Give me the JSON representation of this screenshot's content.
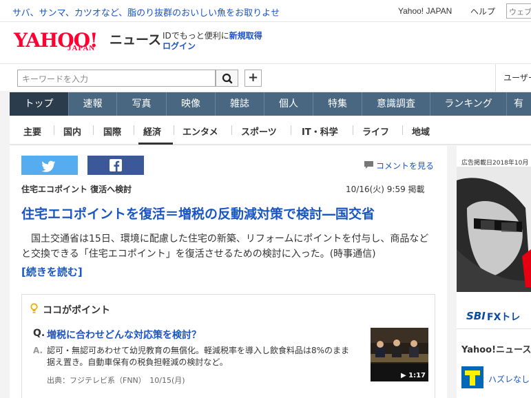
{
  "topbar": {
    "promo": "サバ、サンマ、カツオなど、脂のり抜群のおいしい魚をお取りよせ",
    "yahoo_japan": "Yahoo! JAPAN",
    "help": "ヘルプ",
    "search_placeholder": "ウェブ"
  },
  "logo": {
    "yahoo": "YAHOO!",
    "japan": "JAPAN",
    "news": "ニュース"
  },
  "account": {
    "prefix": "IDでもっと便利に",
    "signup": "新規取得",
    "login": "ログイン"
  },
  "search": {
    "placeholder": "キーワードを入力",
    "plus": "+",
    "user_area": "ユーザー"
  },
  "main_nav": [
    "トップ",
    "速報",
    "写真",
    "映像",
    "雑誌",
    "個人",
    "特集",
    "意識調査",
    "ランキング",
    "有"
  ],
  "sub_nav": [
    "主要",
    "国内",
    "国際",
    "経済",
    "エンタメ",
    "スポーツ",
    "IT・科学",
    "ライフ",
    "地域"
  ],
  "article": {
    "comment_link": "コメントを見る",
    "category": "住宅エコポイント 復活へ検討",
    "date": "10/16(火) 9:59 掲載",
    "headline": "住宅エコポイントを復活＝増税の反動減対策で検討―国交省",
    "lead": "　国土交通省は15日、環境に配慮した住宅の新築、リフォームにポイントを付与し、商品などと交換できる「住宅エコポイント」を復活させるための検討に入った。(時事通信)",
    "more": "[続きを読む]"
  },
  "point": {
    "title": "ココがポイント",
    "q_label": "Q.",
    "question": "増税に合わせどんな対応策を検討？",
    "a_label": "A.",
    "answer": "認可・無認可あわせて幼児教育の無償化。軽減税率を導入し飲食料品は8%のまま据え置き。自動車保有の税負担軽減の検討など。",
    "source": "出典：フジテレビ系（FNN）　10/15(月)",
    "video_duration": "1:17"
  },
  "sidebar": {
    "ad_label": "広告掲載日2018年10月",
    "sbi_logo": "SBI",
    "sbi_text": "FXトレ",
    "ynews_heading": "Yahoo!ニュース",
    "tpoint_text": "ハズレなし"
  },
  "colors": {
    "nav_bg": "#4a6782",
    "nav_active": "#2b3c4d",
    "link": "#1a55c4",
    "twitter": "#55acee",
    "facebook": "#3b5998",
    "yahoo_red": "#ff0033"
  }
}
